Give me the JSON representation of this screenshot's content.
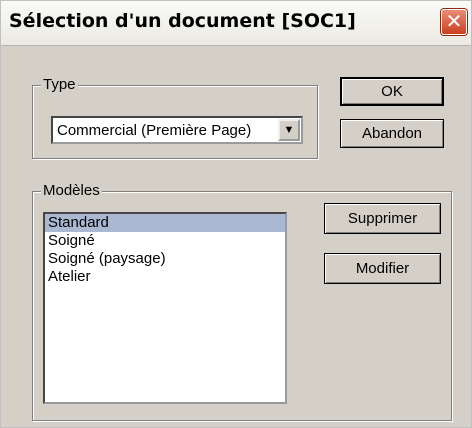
{
  "window": {
    "title": "Sélection d'un document [SOC1]",
    "close_glyph": "✕"
  },
  "type_group": {
    "legend": "Type",
    "selected_value": "Commercial (Première Page)",
    "arrow_glyph": "▼"
  },
  "buttons": {
    "ok": "OK",
    "cancel": "Abandon",
    "delete": "Supprimer",
    "modify": "Modifier"
  },
  "models_group": {
    "legend": "Modèles",
    "items": [
      "Standard",
      "Soigné",
      "Soigné (paysage)",
      "Atelier"
    ],
    "selected_index": 0
  },
  "colors": {
    "selection": "#aab8d2",
    "dialog_face": "#d4d0c8",
    "close_button": "#c9401f"
  }
}
